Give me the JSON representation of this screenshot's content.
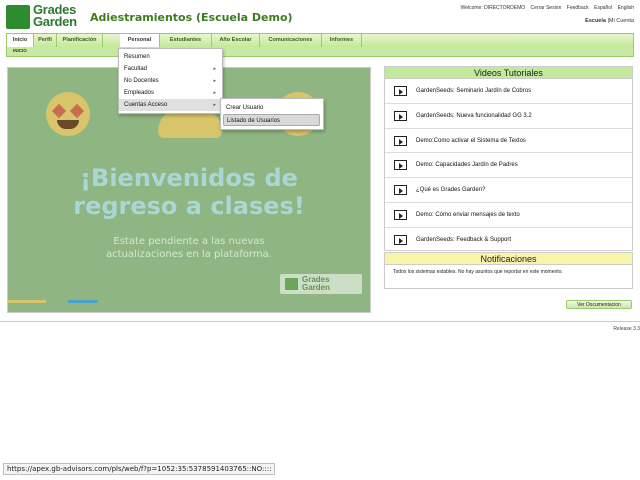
{
  "header": {
    "logo_line1": "Grades",
    "logo_line2": "Garden",
    "app_title": "Adiestramientos (Escuela Demo)",
    "top_links": [
      "Welcome: DIRECTORDEMO",
      "Cerrar Sesion",
      "Feedback",
      "Español",
      "English"
    ],
    "school_label": "Escuela",
    "account_link": "Mi Cuenta",
    "separator": "|"
  },
  "nav": {
    "tabs": [
      "Inicio",
      "Perfil",
      "Planificación",
      "Personal",
      "Estudiantes",
      "Año Escolar",
      "Comunicaciones",
      "Informes"
    ],
    "active_tab": "Inicio",
    "breadcrumb": "INICIO"
  },
  "personal_menu": {
    "items": [
      {
        "label": "Resumen",
        "has_submenu": false
      },
      {
        "label": "Facultad",
        "has_submenu": true
      },
      {
        "label": "No Docentes",
        "has_submenu": true
      },
      {
        "label": "Empleados",
        "has_submenu": true
      },
      {
        "label": "Cuentas Acceso",
        "has_submenu": true
      }
    ],
    "arrow_glyph": "▸"
  },
  "cuentas_submenu": {
    "items": [
      "Crear Usuario",
      "Listado de Usuarios"
    ],
    "selected": "Listado de Usuarios"
  },
  "banner": {
    "title_line1": "¡Bienvenidos de",
    "title_line2": "regreso a clases!",
    "subtitle_line1": "Estate pendiente a las nuevas",
    "subtitle_line2": "actualizaciones en la plataforma.",
    "logo_line1": "Grades",
    "logo_line2": "Garden",
    "bg_color": "#8fb682"
  },
  "videos": {
    "header": "Videos Tutoriales",
    "header_color": "#c3ea9c",
    "items": [
      "GardenSeeds: Seminario Jardín de Cobros",
      "GardenSeeds: Nueva funcionalidad GG 3.2",
      "Demo:Como activar el Sistema de Textos",
      "Demo: Capacidades Jardín de Padres",
      "¿Qué es Grades Garden?",
      "Demo: Cómo enviar mensajes de texto",
      "GardenSeeds: Feedback & Support"
    ]
  },
  "notifications": {
    "header": "Notificaciones",
    "header_color": "#f6f5a8",
    "text": "Todos los sistemas estables. No hay asuntos que reportar en este momento."
  },
  "doc_button": "Ver Documentacion",
  "release": "Release 3.3",
  "status_url": "https://apex.gb-advisors.com/pls/web/f?p=1052:35:5378591403765::NO::::"
}
